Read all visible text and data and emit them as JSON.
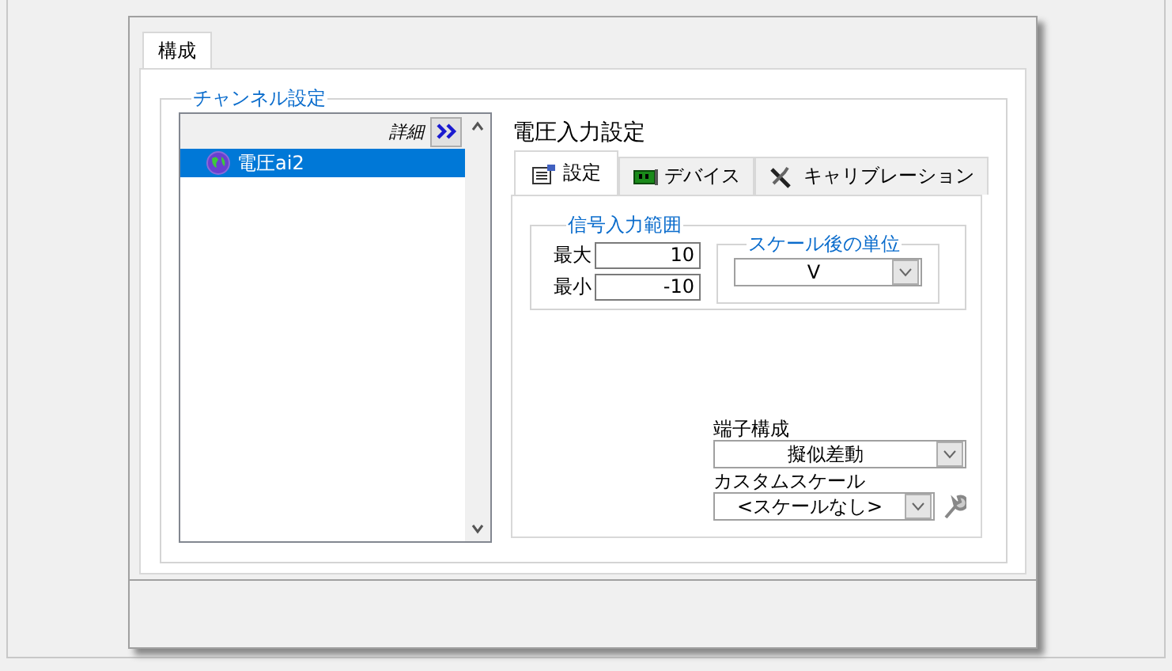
{
  "dialog": {
    "tabs": [
      {
        "label": "構成",
        "selected": true
      }
    ]
  },
  "channel_settings": {
    "legend": "チャンネル設定",
    "details_label": "詳細",
    "channels": [
      {
        "name": "電圧ai2",
        "selected": true
      }
    ]
  },
  "voltage_settings": {
    "title": "電圧入力設定",
    "tabs": [
      {
        "label": "設定",
        "kind": "settings",
        "selected": true
      },
      {
        "label": "デバイス",
        "kind": "device",
        "selected": false
      },
      {
        "label": "キャリブレーション",
        "kind": "calibration",
        "selected": false
      }
    ],
    "signal_range": {
      "legend": "信号入力範囲",
      "max_label": "最大",
      "max": "10",
      "min_label": "最小",
      "min": "-10"
    },
    "scaled_units": {
      "legend": "スケール後の単位",
      "value": "V"
    },
    "terminal_config": {
      "label": "端子構成",
      "value": "擬似差動"
    },
    "custom_scale": {
      "label": "カスタムスケール",
      "value": "<スケールなし>"
    }
  }
}
